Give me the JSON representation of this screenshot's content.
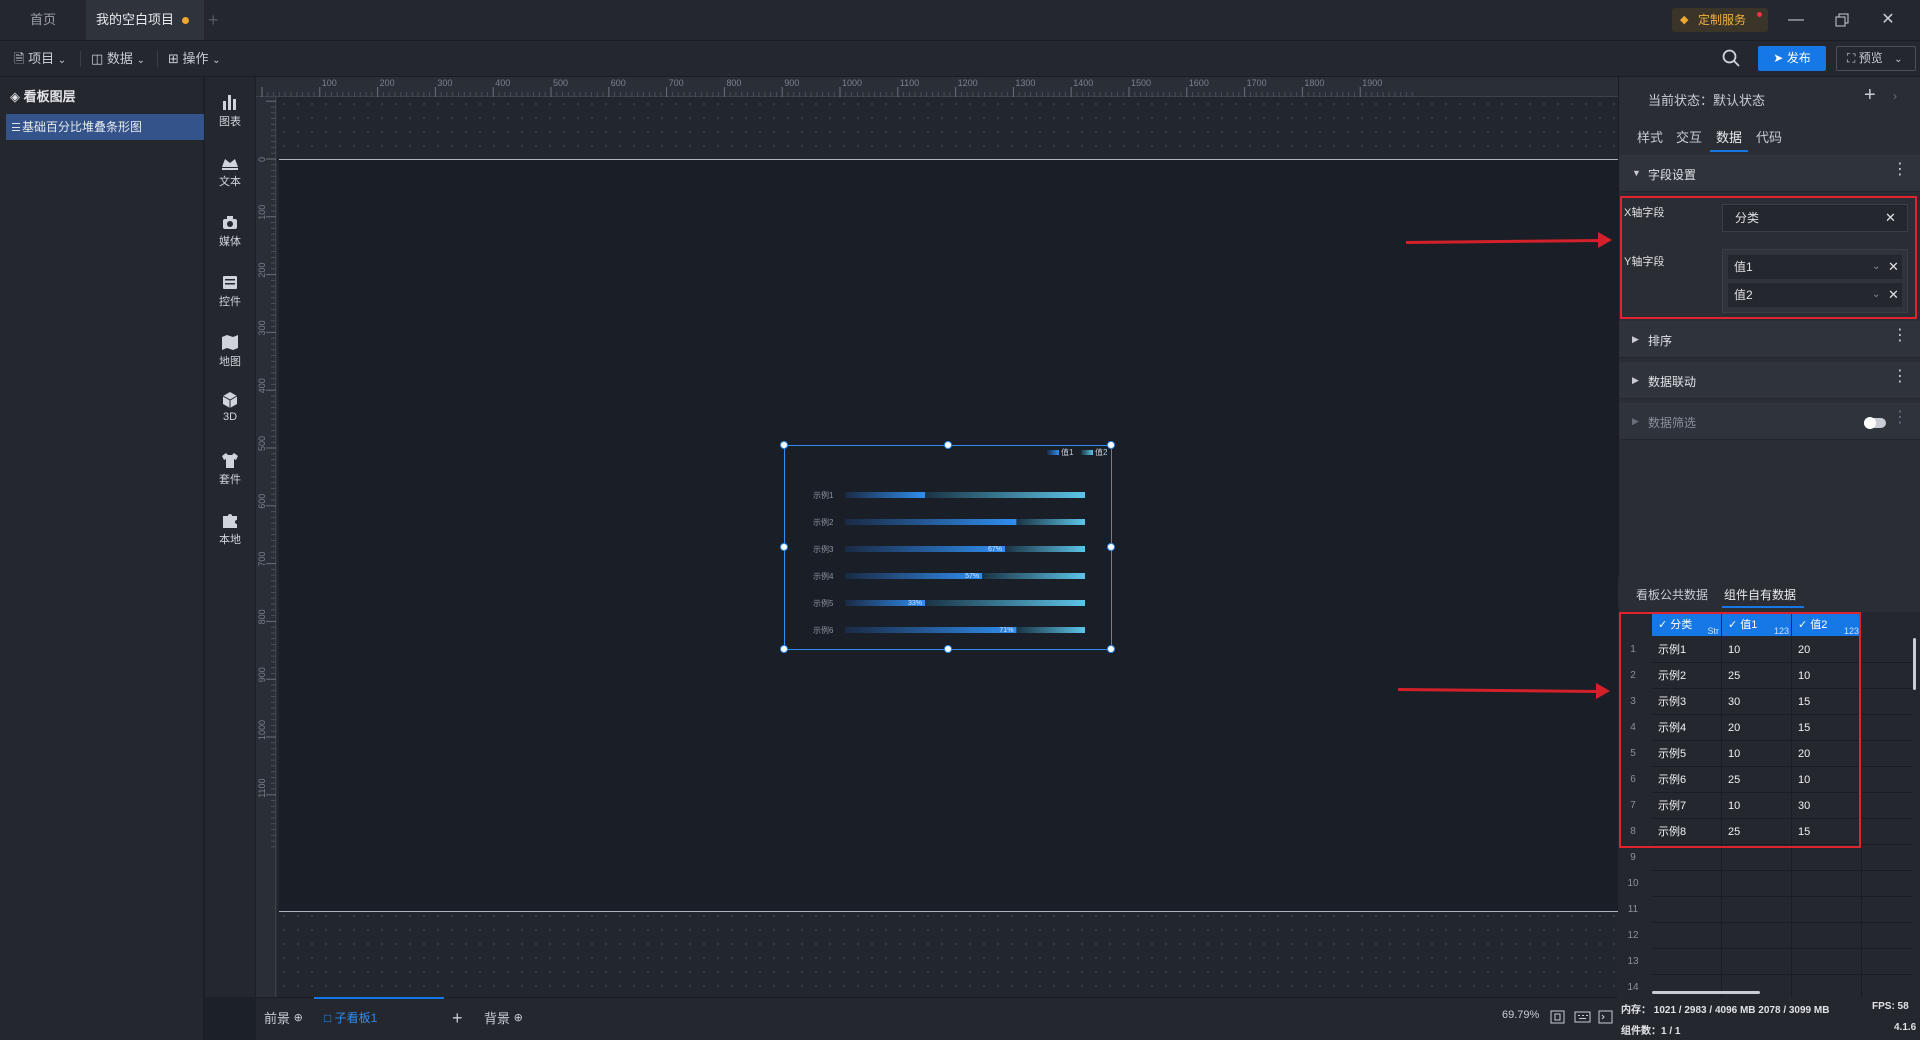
{
  "titlebar": {
    "tabs": [
      "首页",
      "我的空白项目"
    ],
    "custom_service": "定制服务",
    "window_controls": [
      "minimize-icon",
      "restore-icon",
      "close-icon"
    ]
  },
  "toolbar": {
    "menus": [
      "项目",
      "数据",
      "操作"
    ],
    "publish_label": "发布",
    "preview_label": "预览"
  },
  "layers": {
    "title": "看板图层",
    "items": [
      "基础百分比堆叠条形图"
    ]
  },
  "components": [
    "图表",
    "文本",
    "媒体",
    "控件",
    "地图",
    "3D",
    "套件",
    "本地"
  ],
  "ruler": {
    "top": [
      "100",
      "200",
      "300",
      "400",
      "500",
      "600",
      "700",
      "800",
      "900",
      "1000",
      "1100",
      "1200",
      "1300",
      "1400",
      "1500",
      "1600",
      "1700",
      "1800",
      "1900"
    ],
    "left": [
      "0",
      "100",
      "200",
      "300",
      "400",
      "500",
      "600",
      "700",
      "800",
      "900",
      "1000",
      "1100"
    ]
  },
  "chart_data": {
    "type": "bar",
    "legend": [
      "值1",
      "值2"
    ],
    "legend_position": "top-right",
    "categories": [
      "示例1",
      "示例2",
      "示例3",
      "示例4",
      "示例5",
      "示例6"
    ],
    "series": [
      {
        "name": "值1",
        "values": [
          10,
          25,
          30,
          20,
          10,
          25
        ]
      },
      {
        "name": "值2",
        "values": [
          20,
          10,
          15,
          15,
          20,
          10
        ]
      }
    ],
    "percent_labels": [
      "67%",
      "57%",
      "33%",
      "71%"
    ]
  },
  "bottom_bar": {
    "tabs": [
      "前景",
      "子看板1",
      "背景"
    ],
    "zoom": "69.79%"
  },
  "right_panel": {
    "state_label": "当前状态：默认状态",
    "tabs": [
      "样式",
      "交互",
      "数据",
      "代码"
    ],
    "active_tab": "数据",
    "sections": {
      "field_settings": "字段设置",
      "sort": "排序",
      "data_link": "数据联动",
      "data_filter": "数据筛选"
    },
    "x_label": "X轴字段",
    "x_value": "分类",
    "y_label": "Y轴字段",
    "y_values": [
      "值1",
      "值2"
    ],
    "data_tabs": [
      "看板公共数据",
      "组件自有数据"
    ]
  },
  "table": {
    "headers": [
      {
        "label": "分类",
        "type": "Str"
      },
      {
        "label": "值1",
        "type": "123"
      },
      {
        "label": "值2",
        "type": "123"
      }
    ],
    "rows": [
      [
        "示例1",
        "10",
        "20"
      ],
      [
        "示例2",
        "25",
        "10"
      ],
      [
        "示例3",
        "30",
        "15"
      ],
      [
        "示例4",
        "20",
        "15"
      ],
      [
        "示例5",
        "10",
        "20"
      ],
      [
        "示例6",
        "25",
        "10"
      ],
      [
        "示例7",
        "10",
        "30"
      ],
      [
        "示例8",
        "25",
        "15"
      ]
    ],
    "row_numbers": [
      "1",
      "2",
      "3",
      "4",
      "5",
      "6",
      "7",
      "8",
      "9",
      "10",
      "11",
      "12",
      "13",
      "14"
    ]
  },
  "status": {
    "memory": "内存： 1021 / 2983 / 4096 MB  2078 / 3099 MB",
    "fps": "FPS:  58",
    "components": "组件数：1 / 1",
    "version": "4.1.6"
  }
}
